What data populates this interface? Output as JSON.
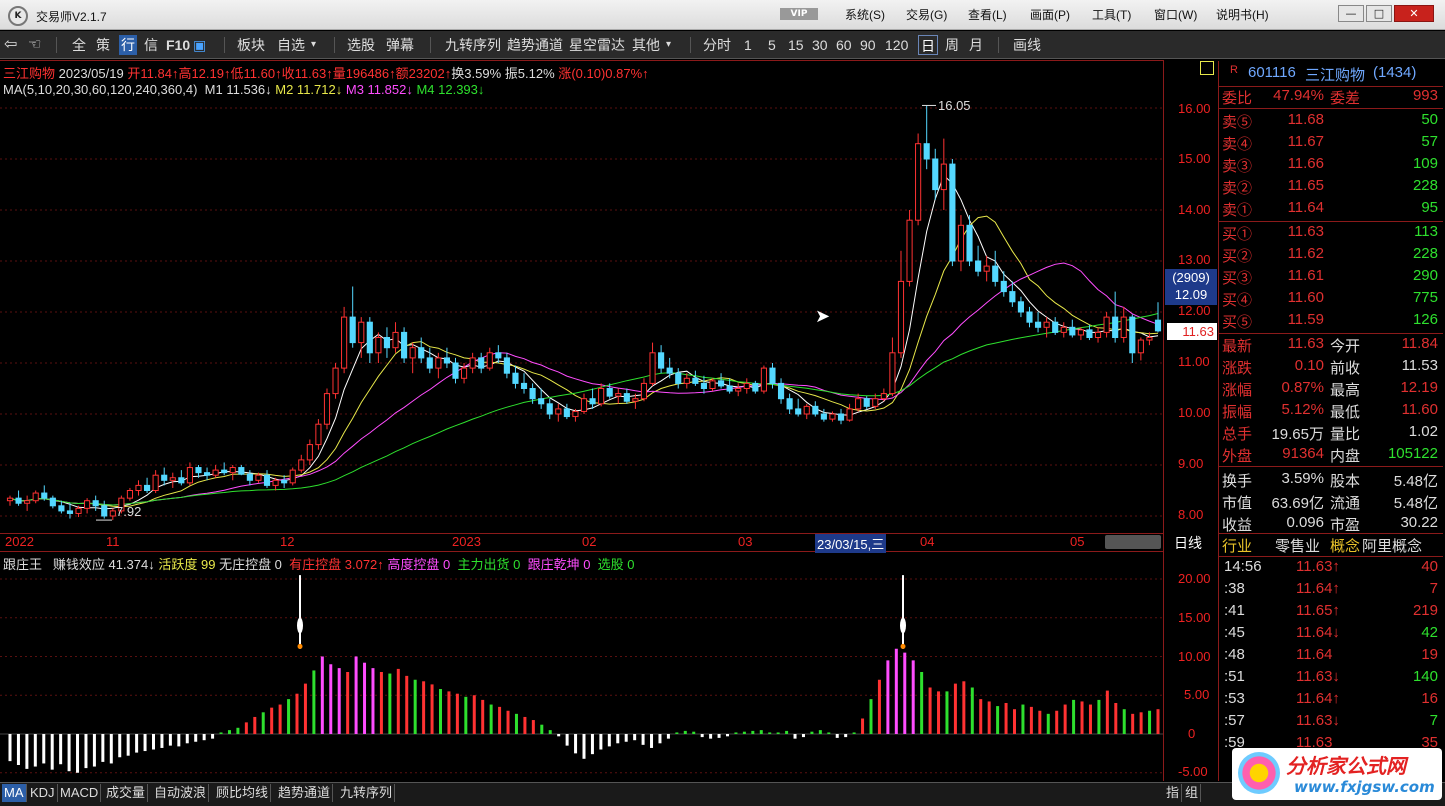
{
  "window": {
    "title": "交易师V2.1.7",
    "vip": "VIP",
    "menus": [
      "系统(S)",
      "交易(G)",
      "查看(L)",
      "画面(P)",
      "工具(T)",
      "窗口(W)",
      "说明书(H)"
    ],
    "min": "—",
    "max": "□",
    "close": "✕"
  },
  "toolbar": {
    "items": [
      "全",
      "策",
      "行",
      "信",
      "F10",
      "板块",
      "自选",
      "选股",
      "弹幕",
      "九转序列",
      "趋势通道",
      "星空雷达",
      "其他",
      "分时",
      "1",
      "5",
      "15",
      "30",
      "60",
      "90",
      "120",
      "日",
      "周",
      "月",
      "画线"
    ]
  },
  "quote": {
    "name": "三江购物",
    "date": "2023/05/19",
    "open_label": "开",
    "open": "11.84",
    "high_label": "高",
    "high": "12.19",
    "low_label": "低",
    "low": "11.60",
    "close_label": "收",
    "close": "11.63",
    "vol_label": "量",
    "vol": "196486",
    "amt_label": "额",
    "amt": "23202",
    "turn_label": "换",
    "turn": "3.59%",
    "amp_label": "振",
    "amp": "5.12%",
    "chg_label": "涨",
    "chg": "(0.10)0.87%"
  },
  "ma": {
    "label": "MA(5,10,20,30,60,120,240,360,4)",
    "m1": "M1 11.536",
    "m2": "M2 11.712",
    "m3": "M3 11.852",
    "m4": "M4 12.393"
  },
  "indicator": {
    "name": "跟庄王",
    "earn": "赚钱效应 41.374",
    "active": "活跃度 99",
    "nozhuang": "无庄控盘 0",
    "youzhuang": "有庄控盘 3.072",
    "gaodu": "高度控盘 0",
    "zhuli": "主力出货 0",
    "genzhuang": "跟庄乾坤 0",
    "xuangu": "选股 0"
  },
  "price_axis": [
    "16.00",
    "15.00",
    "14.00",
    "13.00",
    "12.00",
    "11.00",
    "10.00",
    "9.00",
    "8.00"
  ],
  "ind_axis": [
    "20.00",
    "15.00",
    "10.00",
    "5.00",
    "0",
    "-5.00"
  ],
  "date_axis": [
    "2022",
    "11",
    "12",
    "2023",
    "02",
    "03",
    "23/03/15,三",
    "04",
    "05"
  ],
  "period_label": "日线",
  "annotations": {
    "high": "16.05",
    "low": "7.92",
    "cur_price": "11.63",
    "cross_count": "(2909)",
    "cross_price": "12.09"
  },
  "chart_data": {
    "type": "candlestick",
    "ylim": [
      7.8,
      16.5
    ],
    "candles": [
      [
        8.3,
        8.4,
        8.2,
        8.35
      ],
      [
        8.35,
        8.5,
        8.2,
        8.25
      ],
      [
        8.25,
        8.4,
        8.1,
        8.3
      ],
      [
        8.3,
        8.5,
        8.25,
        8.45
      ],
      [
        8.45,
        8.6,
        8.3,
        8.35
      ],
      [
        8.35,
        8.4,
        8.15,
        8.2
      ],
      [
        8.2,
        8.3,
        8.05,
        8.1
      ],
      [
        8.1,
        8.25,
        7.95,
        8.05
      ],
      [
        8.05,
        8.2,
        7.98,
        8.15
      ],
      [
        8.15,
        8.35,
        8.05,
        8.3
      ],
      [
        8.3,
        8.4,
        8.1,
        8.2
      ],
      [
        8.2,
        8.3,
        7.95,
        8.0
      ],
      [
        8.0,
        8.15,
        7.92,
        8.1
      ],
      [
        8.1,
        8.4,
        8.05,
        8.35
      ],
      [
        8.35,
        8.55,
        8.3,
        8.5
      ],
      [
        8.5,
        8.7,
        8.4,
        8.6
      ],
      [
        8.6,
        8.75,
        8.45,
        8.5
      ],
      [
        8.5,
        8.9,
        8.45,
        8.8
      ],
      [
        8.8,
        8.95,
        8.6,
        8.7
      ],
      [
        8.7,
        8.85,
        8.55,
        8.75
      ],
      [
        8.75,
        8.9,
        8.6,
        8.65
      ],
      [
        8.65,
        9.05,
        8.6,
        8.95
      ],
      [
        8.95,
        9.0,
        8.75,
        8.85
      ],
      [
        8.85,
        8.95,
        8.7,
        8.8
      ],
      [
        8.8,
        9.0,
        8.75,
        8.9
      ],
      [
        8.9,
        9.05,
        8.8,
        8.85
      ],
      [
        8.85,
        9.0,
        8.7,
        8.95
      ],
      [
        8.95,
        9.0,
        8.8,
        8.82
      ],
      [
        8.82,
        8.9,
        8.6,
        8.7
      ],
      [
        8.7,
        8.85,
        8.65,
        8.8
      ],
      [
        8.8,
        8.9,
        8.55,
        8.6
      ],
      [
        8.6,
        8.75,
        8.5,
        8.7
      ],
      [
        8.7,
        8.8,
        8.55,
        8.65
      ],
      [
        8.65,
        8.95,
        8.6,
        8.9
      ],
      [
        8.9,
        9.2,
        8.85,
        9.1
      ],
      [
        9.1,
        9.5,
        9.0,
        9.4
      ],
      [
        9.4,
        9.9,
        9.3,
        9.8
      ],
      [
        9.8,
        10.5,
        9.7,
        10.4
      ],
      [
        10.4,
        11.0,
        10.3,
        10.9
      ],
      [
        10.9,
        12.1,
        10.8,
        11.9
      ],
      [
        11.9,
        12.5,
        11.3,
        11.4
      ],
      [
        11.4,
        11.9,
        11.1,
        11.8
      ],
      [
        11.8,
        11.9,
        11.0,
        11.2
      ],
      [
        11.2,
        11.6,
        11.0,
        11.5
      ],
      [
        11.5,
        11.7,
        11.1,
        11.3
      ],
      [
        11.3,
        11.8,
        11.2,
        11.6
      ],
      [
        11.6,
        11.7,
        11.0,
        11.1
      ],
      [
        11.1,
        11.4,
        10.8,
        11.3
      ],
      [
        11.3,
        11.5,
        11.0,
        11.1
      ],
      [
        11.1,
        11.3,
        10.8,
        10.9
      ],
      [
        10.9,
        11.2,
        10.7,
        11.1
      ],
      [
        11.1,
        11.3,
        10.9,
        11.0
      ],
      [
        11.0,
        11.1,
        10.6,
        10.7
      ],
      [
        10.7,
        11.0,
        10.6,
        10.9
      ],
      [
        10.9,
        11.2,
        10.8,
        11.1
      ],
      [
        11.1,
        11.2,
        10.8,
        10.9
      ],
      [
        10.9,
        11.3,
        10.85,
        11.2
      ],
      [
        11.2,
        11.35,
        11.0,
        11.1
      ],
      [
        11.1,
        11.2,
        10.7,
        10.8
      ],
      [
        10.8,
        10.95,
        10.5,
        10.6
      ],
      [
        10.6,
        10.8,
        10.4,
        10.5
      ],
      [
        10.5,
        10.6,
        10.2,
        10.3
      ],
      [
        10.3,
        10.5,
        10.1,
        10.2
      ],
      [
        10.2,
        10.3,
        9.9,
        10.0
      ],
      [
        10.0,
        10.2,
        9.85,
        10.1
      ],
      [
        10.1,
        10.2,
        9.9,
        9.95
      ],
      [
        9.95,
        10.1,
        9.85,
        10.05
      ],
      [
        10.05,
        10.4,
        10.0,
        10.3
      ],
      [
        10.3,
        10.5,
        10.1,
        10.2
      ],
      [
        10.2,
        10.6,
        10.15,
        10.5
      ],
      [
        10.5,
        10.6,
        10.3,
        10.35
      ],
      [
        10.35,
        10.5,
        10.2,
        10.4
      ],
      [
        10.4,
        10.5,
        10.2,
        10.25
      ],
      [
        10.25,
        10.4,
        10.1,
        10.3
      ],
      [
        10.3,
        10.7,
        10.25,
        10.6
      ],
      [
        10.6,
        11.4,
        10.55,
        11.2
      ],
      [
        11.2,
        11.35,
        10.8,
        10.9
      ],
      [
        10.9,
        11.1,
        10.7,
        10.8
      ],
      [
        10.8,
        10.9,
        10.5,
        10.6
      ],
      [
        10.6,
        10.8,
        10.5,
        10.7
      ],
      [
        10.7,
        10.85,
        10.55,
        10.6
      ],
      [
        10.6,
        10.75,
        10.4,
        10.5
      ],
      [
        10.5,
        10.7,
        10.45,
        10.65
      ],
      [
        10.65,
        10.8,
        10.5,
        10.55
      ],
      [
        10.55,
        10.7,
        10.4,
        10.45
      ],
      [
        10.45,
        10.6,
        10.35,
        10.5
      ],
      [
        10.5,
        10.7,
        10.4,
        10.6
      ],
      [
        10.6,
        10.65,
        10.4,
        10.45
      ],
      [
        10.45,
        10.95,
        10.4,
        10.9
      ],
      [
        10.9,
        11.0,
        10.5,
        10.6
      ],
      [
        10.6,
        10.7,
        10.2,
        10.3
      ],
      [
        10.3,
        10.4,
        10.0,
        10.1
      ],
      [
        10.1,
        10.3,
        9.95,
        10.0
      ],
      [
        10.0,
        10.2,
        9.9,
        10.15
      ],
      [
        10.15,
        10.25,
        9.95,
        10.0
      ],
      [
        10.0,
        10.1,
        9.85,
        9.9
      ],
      [
        9.9,
        10.05,
        9.85,
        10.0
      ],
      [
        10.0,
        10.1,
        9.8,
        9.88
      ],
      [
        9.88,
        10.2,
        9.85,
        10.1
      ],
      [
        10.1,
        10.4,
        10.05,
        10.3
      ],
      [
        10.3,
        10.35,
        10.1,
        10.15
      ],
      [
        10.15,
        10.4,
        10.1,
        10.3
      ],
      [
        10.3,
        10.5,
        10.25,
        10.4
      ],
      [
        10.4,
        11.5,
        10.35,
        11.2
      ],
      [
        11.2,
        13.2,
        11.1,
        12.6
      ],
      [
        12.6,
        14.0,
        12.5,
        13.8
      ],
      [
        13.8,
        15.5,
        13.7,
        15.3
      ],
      [
        15.3,
        16.05,
        14.8,
        15.0
      ],
      [
        15.0,
        15.2,
        14.2,
        14.4
      ],
      [
        14.4,
        15.4,
        14.0,
        14.9
      ],
      [
        14.9,
        15.0,
        12.9,
        13.0
      ],
      [
        13.0,
        13.9,
        12.8,
        13.7
      ],
      [
        13.7,
        13.9,
        12.9,
        13.0
      ],
      [
        13.0,
        13.3,
        12.7,
        12.8
      ],
      [
        12.8,
        13.1,
        12.6,
        12.9
      ],
      [
        12.9,
        13.2,
        12.5,
        12.6
      ],
      [
        12.6,
        12.8,
        12.3,
        12.4
      ],
      [
        12.4,
        12.6,
        12.1,
        12.2
      ],
      [
        12.2,
        12.3,
        11.9,
        12.0
      ],
      [
        12.0,
        12.1,
        11.7,
        11.8
      ],
      [
        11.8,
        12.0,
        11.6,
        11.7
      ],
      [
        11.7,
        11.9,
        11.5,
        11.8
      ],
      [
        11.8,
        11.9,
        11.55,
        11.6
      ],
      [
        11.6,
        11.8,
        11.5,
        11.7
      ],
      [
        11.7,
        11.85,
        11.5,
        11.55
      ],
      [
        11.55,
        11.7,
        11.45,
        11.65
      ],
      [
        11.65,
        11.75,
        11.45,
        11.5
      ],
      [
        11.5,
        11.7,
        11.4,
        11.6
      ],
      [
        11.6,
        12.0,
        11.5,
        11.9
      ],
      [
        11.9,
        12.4,
        11.4,
        11.5
      ],
      [
        11.5,
        12.1,
        11.4,
        11.9
      ],
      [
        11.9,
        11.95,
        11.0,
        11.2
      ],
      [
        11.2,
        11.5,
        11.05,
        11.45
      ],
      [
        11.45,
        11.6,
        11.35,
        11.5
      ],
      [
        11.84,
        12.19,
        11.6,
        11.63
      ]
    ],
    "ma_colors": [
      "#ffffff",
      "#e8e84a",
      "#ff4dff",
      "#2ee02e"
    ],
    "ind_values": [
      -3.5,
      -4.0,
      -4.5,
      -4.2,
      -3.8,
      -4.6,
      -3.9,
      -4.8,
      -5.0,
      -4.4,
      -4.2,
      -3.6,
      -3.8,
      -3.0,
      -2.8,
      -2.4,
      -2.2,
      -2.0,
      -1.8,
      -1.5,
      -1.6,
      -1.2,
      -1.0,
      -0.8,
      -0.6,
      0.2,
      0.5,
      0.8,
      1.5,
      2.2,
      2.8,
      3.4,
      3.8,
      4.5,
      5.2,
      6.5,
      8.2,
      10.0,
      9.0,
      8.5,
      8.0,
      10.0,
      9.2,
      8.5,
      8.0,
      7.8,
      8.4,
      7.5,
      7.0,
      6.8,
      6.4,
      5.8,
      5.5,
      5.2,
      4.8,
      5.0,
      4.4,
      3.8,
      3.5,
      3.0,
      2.6,
      2.2,
      1.8,
      1.2,
      0.5,
      -0.3,
      -1.5,
      -2.5,
      -3.2,
      -2.6,
      -2.0,
      -1.6,
      -1.2,
      -1.0,
      -0.8,
      -1.4,
      -1.8,
      -1.2,
      -0.6,
      0.2,
      0.4,
      0.3,
      -0.4,
      -0.6,
      -0.5,
      -0.3,
      0.2,
      0.3,
      0.4,
      0.5,
      0.2,
      0.2,
      0.4,
      -0.6,
      -0.4,
      0.3,
      0.5,
      0.2,
      -0.5,
      -0.4,
      0.2,
      2.0,
      4.5,
      7.0,
      9.5,
      11.0,
      10.5,
      9.5,
      8.0,
      6.0,
      5.5,
      5.5,
      6.5,
      6.8,
      6.0,
      4.5,
      4.2,
      3.6,
      4.0,
      3.2,
      3.8,
      3.5,
      3.0,
      2.6,
      3.0,
      3.8,
      4.4,
      4.2,
      3.8,
      4.4,
      5.6,
      4.0,
      3.2,
      2.6,
      2.8,
      3.0,
      3.2
    ],
    "ind_ylim": [
      -5.5,
      21
    ],
    "type_note": "candles as [open,high,low,close]"
  },
  "stock": {
    "code_label": "R",
    "code": "601116",
    "name": "三江购物",
    "count": "(1434)",
    "weibi_l": "委比",
    "weibi": "47.94%",
    "weicha_l": "委差",
    "weicha": "993",
    "sells": [
      {
        "label": "卖⑤",
        "price": "11.68",
        "vol": "50"
      },
      {
        "label": "卖④",
        "price": "11.67",
        "vol": "57"
      },
      {
        "label": "卖③",
        "price": "11.66",
        "vol": "109"
      },
      {
        "label": "卖②",
        "price": "11.65",
        "vol": "228"
      },
      {
        "label": "卖①",
        "price": "11.64",
        "vol": "95"
      }
    ],
    "buys": [
      {
        "label": "买①",
        "price": "11.63",
        "vol": "113"
      },
      {
        "label": "买②",
        "price": "11.62",
        "vol": "228"
      },
      {
        "label": "买③",
        "price": "11.61",
        "vol": "290"
      },
      {
        "label": "买④",
        "price": "11.60",
        "vol": "775"
      },
      {
        "label": "买⑤",
        "price": "11.59",
        "vol": "126"
      }
    ],
    "stats": [
      [
        "最新",
        "11.63",
        "今开",
        "11.84"
      ],
      [
        "涨跌",
        "0.10",
        "前收",
        "11.53"
      ],
      [
        "涨幅",
        "0.87%",
        "最高",
        "12.19"
      ],
      [
        "振幅",
        "5.12%",
        "最低",
        "11.60"
      ],
      [
        "总手",
        "19.65万",
        "量比",
        "1.02"
      ],
      [
        "外盘",
        "91364",
        "内盘",
        "105122"
      ],
      [
        "换手",
        "3.59%",
        "股本",
        "5.48亿"
      ],
      [
        "市值",
        "63.69亿",
        "流通",
        "5.48亿"
      ],
      [
        "收益",
        "0.096",
        "市盈",
        "30.22"
      ]
    ],
    "industry_l": "行业",
    "industry": "零售业",
    "concept_l": "概念",
    "concept": "阿里概念",
    "ticks": [
      {
        "t": "14:56",
        "p": "11.63↑",
        "v": "40"
      },
      {
        "t": ":38",
        "p": "11.64↑",
        "v": "7"
      },
      {
        "t": ":41",
        "p": "11.65↑",
        "v": "219"
      },
      {
        "t": ":45",
        "p": "11.64↓",
        "v": "42"
      },
      {
        "t": ":48",
        "p": "11.64",
        "v": "19"
      },
      {
        "t": ":51",
        "p": "11.63↓",
        "v": "140"
      },
      {
        "t": ":53",
        "p": "11.64↑",
        "v": "16"
      },
      {
        "t": ":57",
        "p": "11.63↓",
        "v": "7"
      },
      {
        "t": ":59",
        "p": "11.63",
        "v": "35"
      }
    ]
  },
  "bottom_tabs": [
    "MA",
    "KDJ",
    "MACD",
    "成交量",
    "自动波浪",
    "顾比均线",
    "趋势通道",
    "九转序列"
  ],
  "bottom_right": [
    "指",
    "组"
  ],
  "watermark": {
    "text": "分析家公式网",
    "url": "www.fxjgsw.com"
  }
}
